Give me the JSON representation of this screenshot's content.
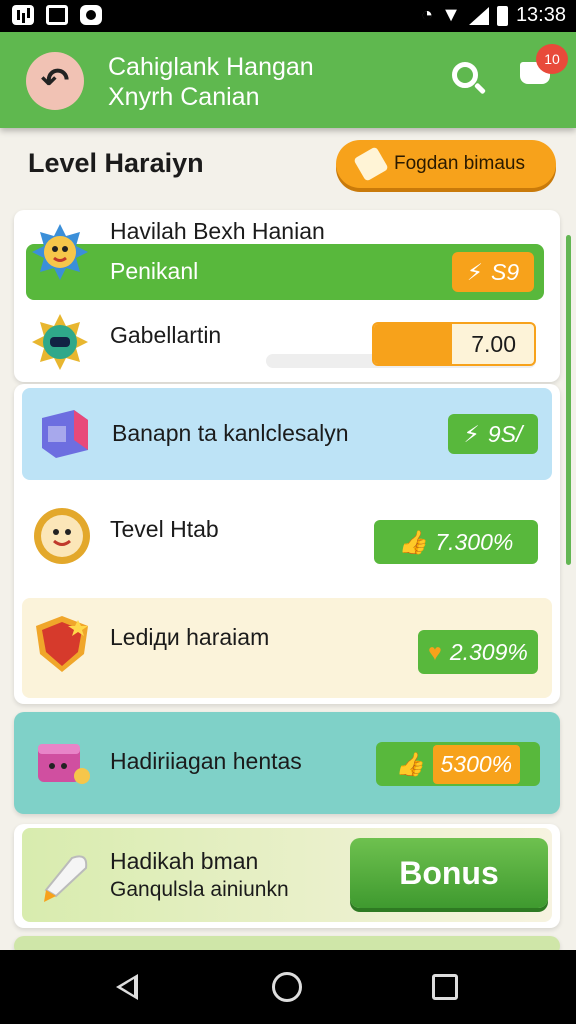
{
  "status_bar": {
    "time": "13:38"
  },
  "app_bar": {
    "title_line1": "Cahiglank Hangan",
    "title_line2": "Xnyrh Canian",
    "cart_badge": "10"
  },
  "header": {
    "title": "Level Haraiyn",
    "bonus_button": "Fogdan bimaus"
  },
  "card1": {
    "heading": "Havilah Bexh Hanian",
    "items": [
      {
        "label": "Penikanl",
        "value": "S9"
      },
      {
        "label": "Gabellartin",
        "value": "7.00"
      }
    ]
  },
  "rows": [
    {
      "label": "Banapn ta kanlclesalyn",
      "value": "9S/"
    },
    {
      "label": "Tevel Htab",
      "value": "7.300%"
    },
    {
      "label": "Lediди haraiam",
      "value": "2.309%"
    }
  ],
  "teal_row": {
    "label": "Hadiriiagan hentas",
    "value": "5300%"
  },
  "bonus_card": {
    "line1": "Hadikah bman",
    "line2": "Ganqulsla ainiunkn",
    "button": "Bonus"
  },
  "colors": {
    "primary_green": "#5fb84f",
    "orange": "#f7a21b",
    "light_blue": "#bde3f6",
    "cream": "#fbf3da",
    "teal": "#7fd1c8"
  }
}
